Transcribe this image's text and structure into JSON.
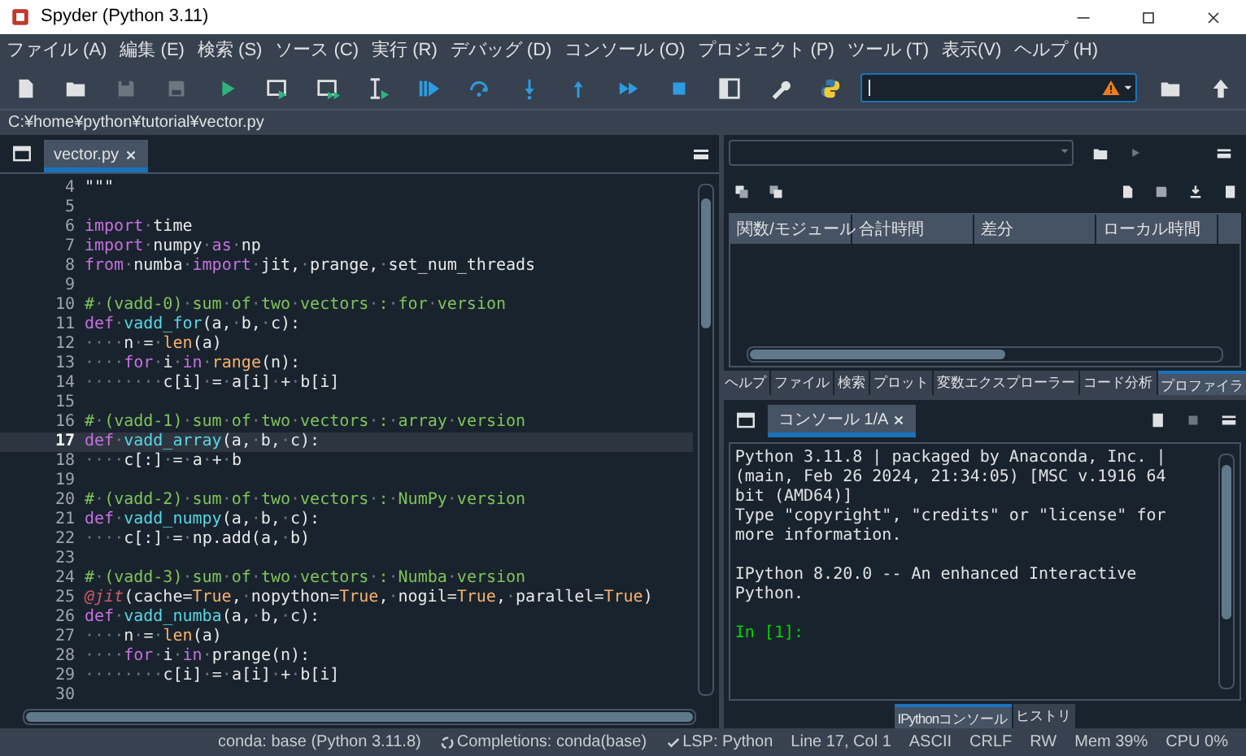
{
  "window": {
    "title": "Spyder (Python 3.11)"
  },
  "menu": [
    "ファイル (A)",
    "編集 (E)",
    "検索 (S)",
    "ソース (C)",
    "実行 (R)",
    "デバッグ (D)",
    "コンソール (O)",
    "プロジェクト (P)",
    "ツール (T)",
    "表示(V)",
    "ヘルプ (H)"
  ],
  "path": "C:¥home¥python¥tutorial¥vector.py",
  "editor": {
    "tabs": [
      {
        "label": "vector.py",
        "selected": true
      }
    ],
    "lines": [
      {
        "number": "4",
        "current": false,
        "tokens": [
          {
            "kind": "pl",
            "text": "\"\"\""
          }
        ]
      },
      {
        "number": "5",
        "current": false
      },
      {
        "number": "6",
        "current": false,
        "tokens": [
          {
            "kind": "kw",
            "text": "import"
          },
          {
            "kind": "pl",
            "text": "·time"
          }
        ]
      },
      {
        "number": "7",
        "current": false,
        "tokens": [
          {
            "kind": "kw",
            "text": "import"
          },
          {
            "kind": "pl",
            "text": "·numpy·"
          },
          {
            "kind": "kw",
            "text": "as"
          },
          {
            "kind": "pl",
            "text": "·np"
          }
        ]
      },
      {
        "number": "8",
        "current": false,
        "tokens": [
          {
            "kind": "kw",
            "text": "from"
          },
          {
            "kind": "pl",
            "text": "·numba·"
          },
          {
            "kind": "kw",
            "text": "import"
          },
          {
            "kind": "pl",
            "text": "·jit,·prange,·set_num_threads"
          }
        ]
      },
      {
        "number": "9",
        "current": false
      },
      {
        "number": "10",
        "current": false,
        "tokens": [
          {
            "kind": "cm",
            "text": "#·(vadd-0)·sum·of·two·vectors·:·for·version"
          }
        ]
      },
      {
        "number": "11",
        "current": false,
        "tokens": [
          {
            "kind": "kw",
            "text": "def"
          },
          {
            "kind": "pl",
            "text": "·"
          },
          {
            "kind": "fn",
            "text": "vadd_for"
          },
          {
            "kind": "pl",
            "text": "(a,·b,·c):"
          }
        ]
      },
      {
        "number": "12",
        "current": false,
        "tokens": [
          {
            "kind": "pl",
            "text": "····n·=·"
          },
          {
            "kind": "bi",
            "text": "len"
          },
          {
            "kind": "pl",
            "text": "(a)"
          }
        ]
      },
      {
        "number": "13",
        "current": false,
        "tokens": [
          {
            "kind": "pl",
            "text": "····"
          },
          {
            "kind": "kw",
            "text": "for"
          },
          {
            "kind": "pl",
            "text": "·i·"
          },
          {
            "kind": "kw",
            "text": "in"
          },
          {
            "kind": "pl",
            "text": "·"
          },
          {
            "kind": "bi",
            "text": "range"
          },
          {
            "kind": "pl",
            "text": "(n):"
          }
        ]
      },
      {
        "number": "14",
        "current": false,
        "tokens": [
          {
            "kind": "pl",
            "text": "········c[i]·=·a[i]·+·b[i]"
          }
        ]
      },
      {
        "number": "15",
        "current": false
      },
      {
        "number": "16",
        "current": false,
        "tokens": [
          {
            "kind": "cm",
            "text": "#·(vadd-1)·sum·of·two·vectors·:·array·version"
          }
        ]
      },
      {
        "number": "17",
        "current": true,
        "tokens": [
          {
            "kind": "kw",
            "text": "def"
          },
          {
            "kind": "pl",
            "text": "·"
          },
          {
            "kind": "fn",
            "text": "vadd_array"
          },
          {
            "kind": "pl",
            "text": "(a,·b,·c):"
          }
        ]
      },
      {
        "number": "18",
        "current": false,
        "tokens": [
          {
            "kind": "pl",
            "text": "····c[:]·=·a·+·b"
          }
        ]
      },
      {
        "number": "19",
        "current": false
      },
      {
        "number": "20",
        "current": false,
        "tokens": [
          {
            "kind": "cm",
            "text": "#·(vadd-2)·sum·of·two·vectors·:·NumPy·version"
          }
        ]
      },
      {
        "number": "21",
        "current": false,
        "tokens": [
          {
            "kind": "kw",
            "text": "def"
          },
          {
            "kind": "pl",
            "text": "·"
          },
          {
            "kind": "fn",
            "text": "vadd_numpy"
          },
          {
            "kind": "pl",
            "text": "(a,·b,·c):"
          }
        ]
      },
      {
        "number": "22",
        "current": false,
        "tokens": [
          {
            "kind": "pl",
            "text": "····c[:]·=·np.add(a,·b)"
          }
        ]
      },
      {
        "number": "23",
        "current": false
      },
      {
        "number": "24",
        "current": false,
        "tokens": [
          {
            "kind": "cm",
            "text": "#·(vadd-3)·sum·of·two·vectors·:·Numba·version"
          }
        ]
      },
      {
        "number": "25",
        "current": false,
        "tokens": [
          {
            "kind": "dec",
            "text": "@jit"
          },
          {
            "kind": "pl",
            "text": "(cache="
          },
          {
            "kind": "co",
            "text": "True"
          },
          {
            "kind": "pl",
            "text": ",·nopython="
          },
          {
            "kind": "co",
            "text": "True"
          },
          {
            "kind": "pl",
            "text": ",·nogil="
          },
          {
            "kind": "co",
            "text": "True"
          },
          {
            "kind": "pl",
            "text": ",·parallel="
          },
          {
            "kind": "co",
            "text": "True"
          },
          {
            "kind": "pl",
            "text": ")"
          }
        ]
      },
      {
        "number": "26",
        "current": false,
        "tokens": [
          {
            "kind": "kw",
            "text": "def"
          },
          {
            "kind": "pl",
            "text": "·"
          },
          {
            "kind": "fn",
            "text": "vadd_numba"
          },
          {
            "kind": "pl",
            "text": "(a,·b,·c):"
          }
        ]
      },
      {
        "number": "27",
        "current": false,
        "tokens": [
          {
            "kind": "pl",
            "text": "····n·=·"
          },
          {
            "kind": "bi",
            "text": "len"
          },
          {
            "kind": "pl",
            "text": "(a)"
          }
        ]
      },
      {
        "number": "28",
        "current": false,
        "tokens": [
          {
            "kind": "pl",
            "text": "····"
          },
          {
            "kind": "kw",
            "text": "for"
          },
          {
            "kind": "pl",
            "text": "·i·"
          },
          {
            "kind": "kw",
            "text": "in"
          },
          {
            "kind": "pl",
            "text": "·prange(n):"
          }
        ]
      },
      {
        "number": "29",
        "current": false,
        "tokens": [
          {
            "kind": "pl",
            "text": "········c[i]·=·a[i]·+·b[i]"
          }
        ]
      },
      {
        "number": "30",
        "current": false
      }
    ]
  },
  "profiler": {
    "columns": [
      "関数/モジュール",
      "合計時間",
      "差分",
      "ローカル時間"
    ],
    "tabs": [
      {
        "label": "ヘルプ",
        "selected": false
      },
      {
        "label": "ファイル",
        "selected": false
      },
      {
        "label": "検索",
        "selected": false
      },
      {
        "label": "プロット",
        "selected": false
      },
      {
        "label": "変数エクスプローラー",
        "selected": false
      },
      {
        "label": "コード分析",
        "selected": false
      },
      {
        "label": "プロファイラ",
        "selected": true
      }
    ]
  },
  "console": {
    "tabs": [
      {
        "label": "コンソール 1/A",
        "selected": true
      }
    ],
    "lines": [
      {
        "kind": "out",
        "text": "Python 3.11.8 | packaged by Anaconda, Inc. |"
      },
      {
        "kind": "out",
        "text": "(main, Feb 26 2024, 21:34:05) [MSC v.1916 64"
      },
      {
        "kind": "out",
        "text": "bit (AMD64)]"
      },
      {
        "kind": "out",
        "text": "Type \"copyright\", \"credits\" or \"license\" for"
      },
      {
        "kind": "out",
        "text": "more information."
      },
      {
        "kind": "blank"
      },
      {
        "kind": "out",
        "text": "IPython 8.20.0 -- An enhanced Interactive"
      },
      {
        "kind": "out",
        "text": "Python."
      },
      {
        "kind": "blank"
      },
      {
        "kind": "prompt",
        "text": "In [1]:"
      }
    ],
    "bottom_tabs": [
      {
        "label": "IPythonコンソール",
        "selected": true
      },
      {
        "label": "ヒストリ",
        "selected": false
      }
    ]
  },
  "status_bar": [
    {
      "kind": "text",
      "text": "conda: base (Python 3.11.8)"
    },
    {
      "kind": "spinner",
      "text": "Completions: conda(base)"
    },
    {
      "kind": "check",
      "text": "LSP: Python"
    },
    {
      "kind": "text",
      "text": "Line 17, Col 1"
    },
    {
      "kind": "text",
      "text": "ASCII"
    },
    {
      "kind": "text",
      "text": "CRLF"
    },
    {
      "kind": "text",
      "text": "RW"
    },
    {
      "kind": "text",
      "text": "Mem 39%"
    },
    {
      "kind": "text",
      "text": "CPU 0%"
    }
  ]
}
